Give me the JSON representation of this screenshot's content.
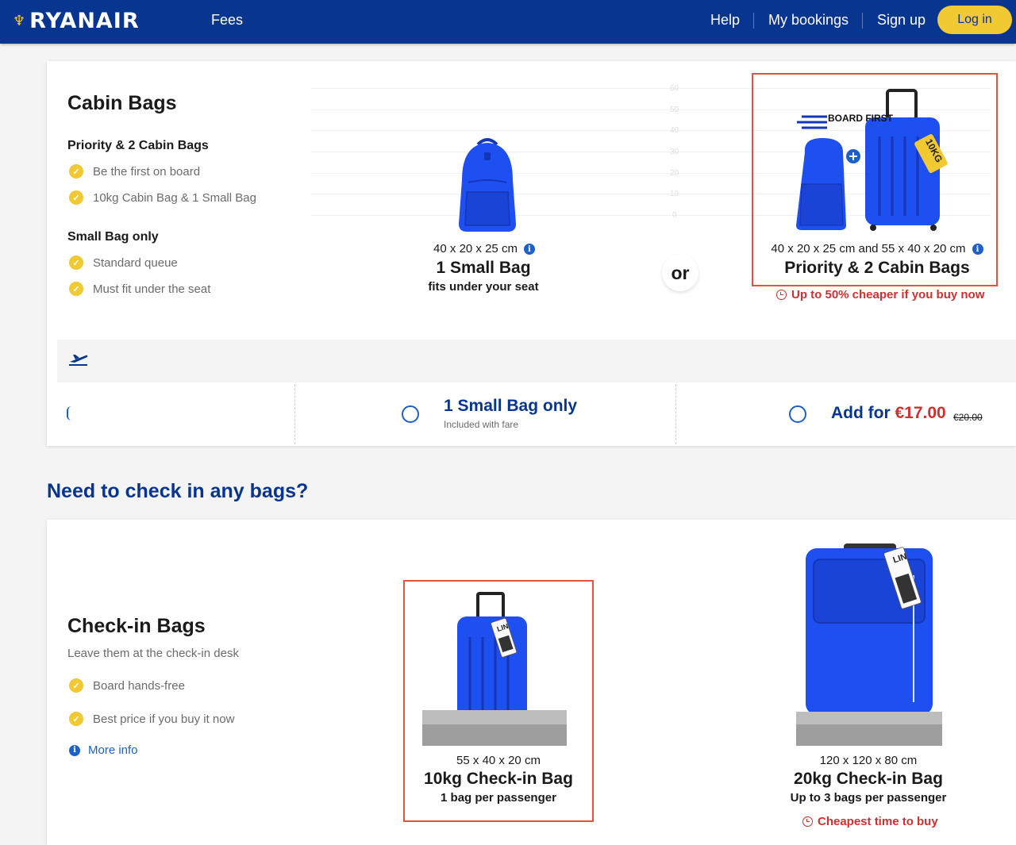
{
  "header": {
    "brand": "RYANAIR",
    "fees": "Fees",
    "help": "Help",
    "my_bookings": "My bookings",
    "sign_up": "Sign up",
    "log_in": "Log in"
  },
  "cabin": {
    "title": "Cabin Bags",
    "priority_heading": "Priority & 2 Cabin Bags",
    "priority_points": [
      "Be the first on board",
      "10kg Cabin Bag & 1 Small Bag"
    ],
    "small_heading": "Small Bag only",
    "small_points": [
      "Standard queue",
      "Must fit under the seat"
    ],
    "small_bag": {
      "dims": "40 x 20 x 25 cm",
      "name": "1 Small Bag",
      "sub": "fits under your seat"
    },
    "or_label": "or",
    "priority_bag": {
      "board_first": "BOARD FIRST",
      "tag": "10KG",
      "dims": "40 x 20 x 25 cm and 55 x 40 x 20 cm",
      "name": "Priority & 2 Cabin Bags",
      "promo": "Up to 50% cheaper if you buy now"
    },
    "faint_ticks": [
      "60",
      "50",
      "40",
      "30",
      "20",
      "10",
      "0"
    ],
    "options": {
      "small_title": "1 Small Bag only",
      "small_sub": "Included with fare",
      "add_label": "Add for",
      "add_price": "€17.00",
      "old_price": "€20.00"
    }
  },
  "checkin": {
    "section_heading": "Need to check in any bags?",
    "title": "Check-in Bags",
    "subtitle": "Leave them at the check-in desk",
    "points": [
      "Board hands-free",
      "Best price if you buy it now"
    ],
    "more_info": "More info",
    "bag10": {
      "tag": "LIN",
      "dims": "55 x 40 x 20 cm",
      "name": "10kg Check-in Bag",
      "sub": "1 bag per passenger"
    },
    "bag20": {
      "tag": "LIN",
      "dims": "120 x 120 x 80 cm",
      "name": "20kg Check-in Bag",
      "sub": "Up to 3 bags per passenger",
      "promo": "Cheapest time to buy"
    }
  },
  "colors": {
    "brand_blue": "#073590",
    "accent_yellow": "#f1c933",
    "promo_red": "#d32f2f",
    "link_blue": "#1c60c9",
    "bag_blue": "#1e4ff0"
  }
}
